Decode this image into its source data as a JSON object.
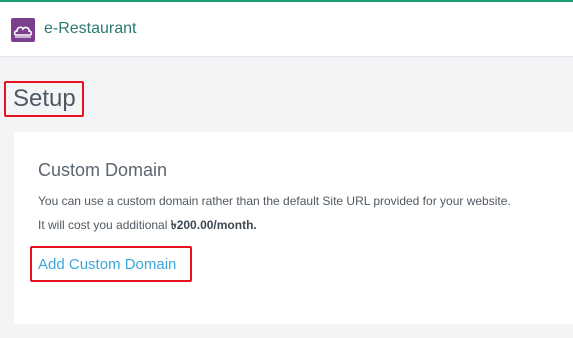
{
  "header": {
    "app_title": "e-Restaurant",
    "logo_icon": "cloud-logo-icon",
    "accent_color": "#1a9e77"
  },
  "page": {
    "title": "Setup"
  },
  "custom_domain": {
    "title": "Custom Domain",
    "description": "You can use a custom domain rather than the default Site URL provided for your website.",
    "cost_prefix": "It will cost you additional ",
    "cost_amount": "৳200.00/month.",
    "add_link": "Add Custom Domain"
  },
  "highlights": {
    "color": "#e8141d"
  }
}
